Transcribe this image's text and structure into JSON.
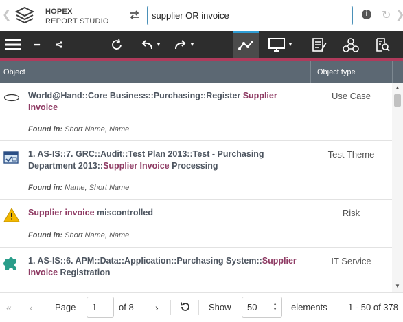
{
  "header": {
    "brand_top": "HOPEX",
    "brand_bottom": "REPORT STUDIO",
    "search_value": "supplier OR invoice",
    "info_label": "i"
  },
  "toolbar": {
    "items": [
      {
        "name": "menu-icon"
      },
      {
        "name": "more-icon"
      },
      {
        "name": "share-icon"
      },
      {
        "name": "refresh-icon"
      },
      {
        "name": "undo-icon"
      },
      {
        "name": "redo-icon"
      },
      {
        "name": "graph-icon",
        "active": true
      },
      {
        "name": "monitor-icon"
      },
      {
        "name": "notes-icon"
      },
      {
        "name": "network-icon"
      },
      {
        "name": "report-search-icon"
      }
    ],
    "accent_color": "#b03a5b",
    "active_color": "#2e9ed6"
  },
  "table": {
    "col_object": "Object",
    "col_type": "Object type",
    "rows": [
      {
        "title_parts": [
          {
            "text": "World@Hand::Core Business::Purchasing::Register ",
            "hl": false
          },
          {
            "text": "Supplier Invoice",
            "hl": true
          }
        ],
        "found_label": "Found in:",
        "found_value": " Short Name, Name",
        "type": "Use Case",
        "icon": "use-case-icon"
      },
      {
        "title_parts": [
          {
            "text": "1. AS-IS::7. GRC::Audit::Test Plan 2013::Test - Purchasing Department 2013::",
            "hl": false
          },
          {
            "text": "Supplier Invoice",
            "hl": true
          },
          {
            "text": " Processing",
            "hl": false
          }
        ],
        "found_label": "Found in:",
        "found_value": " Name, Short Name",
        "type": "Test Theme",
        "icon": "test-theme-icon"
      },
      {
        "title_parts": [
          {
            "text": "Supplier invoice",
            "hl": true
          },
          {
            "text": " miscontrolled",
            "hl": false
          }
        ],
        "found_label": "Found in:",
        "found_value": " Short Name, Name",
        "type": "Risk",
        "icon": "risk-warning-icon"
      },
      {
        "title_parts": [
          {
            "text": "1. AS-IS::6. APM::Data::Application::Purchasing System::",
            "hl": false
          },
          {
            "text": "Supplier Invoice",
            "hl": true
          },
          {
            "text": " Registration",
            "hl": false
          }
        ],
        "found_label": "",
        "found_value": "",
        "type": "IT Service",
        "icon": "it-service-puzzle-icon"
      }
    ]
  },
  "pager": {
    "page_label": "Page",
    "page_value": "1",
    "of_label": "of 8",
    "show_label": "Show",
    "show_value": "50",
    "elements_label": "elements",
    "range_label": "1 - 50 of 378"
  }
}
